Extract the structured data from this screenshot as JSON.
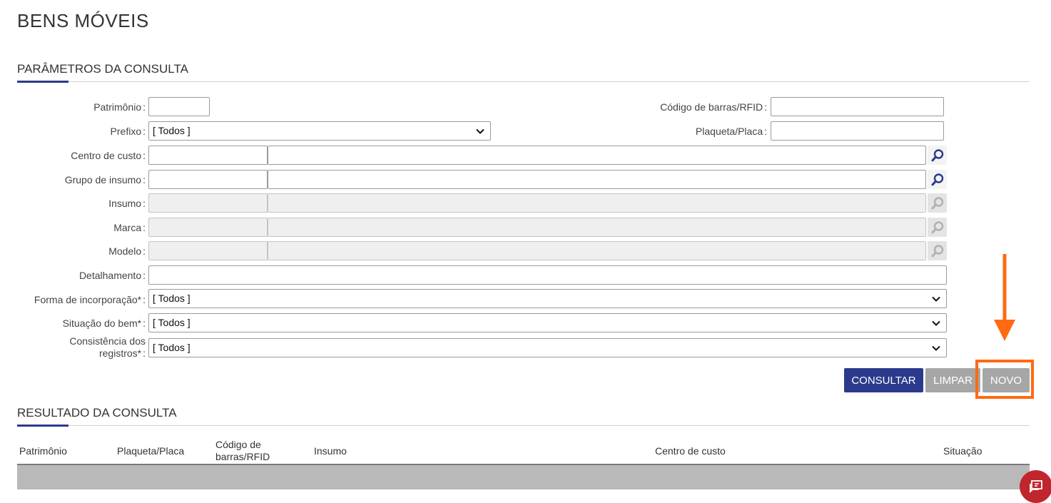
{
  "page": {
    "title": "BENS MÓVEIS"
  },
  "params_section": {
    "title": "PARÂMETROS DA CONSULTA"
  },
  "form": {
    "patrimonio": {
      "label": "Patrimônio",
      "value": ""
    },
    "codigo_barras": {
      "label": "Código de barras/RFID",
      "value": ""
    },
    "prefixo": {
      "label": "Prefixo",
      "selected": "[ Todos ]"
    },
    "plaqueta": {
      "label": "Plaqueta/Placa",
      "value": ""
    },
    "centro_custo": {
      "label": "Centro de custo"
    },
    "grupo_insumo": {
      "label": "Grupo de insumo"
    },
    "insumo": {
      "label": "Insumo"
    },
    "marca": {
      "label": "Marca"
    },
    "modelo": {
      "label": "Modelo"
    },
    "detalhamento": {
      "label": "Detalhamento",
      "value": ""
    },
    "forma_incorporacao": {
      "label": "Forma de incorporação*",
      "selected": "[ Todos ]"
    },
    "situacao_bem": {
      "label": "Situação do bem*",
      "selected": "[ Todos ]"
    },
    "consistencia": {
      "label_line1": "Consistência dos",
      "label_line2": "registros*",
      "selected": "[ Todos ]"
    },
    "colon": ":"
  },
  "buttons": {
    "consultar": "CONSULTAR",
    "limpar": "LIMPAR",
    "novo": "NOVO"
  },
  "results_section": {
    "title": "RESULTADO DA CONSULTA"
  },
  "table": {
    "headers": {
      "patrimonio": "Patrimônio",
      "plaqueta": "Plaqueta/Placa",
      "codigo_line1": "Código de",
      "codigo_line2": "barras/RFID",
      "insumo": "Insumo",
      "centro_custo": "Centro de custo",
      "situacao": "Situação"
    }
  },
  "colors": {
    "primary": "#2b3a8c",
    "secondary_button": "#a6a6a6",
    "highlight": "#ff6a13",
    "chat": "#c0262d"
  },
  "icons": {
    "lookup": "magnifier-icon",
    "dropdown": "chevron-down-icon",
    "annotation": "arrow-down-icon",
    "chat": "chat-icon"
  }
}
